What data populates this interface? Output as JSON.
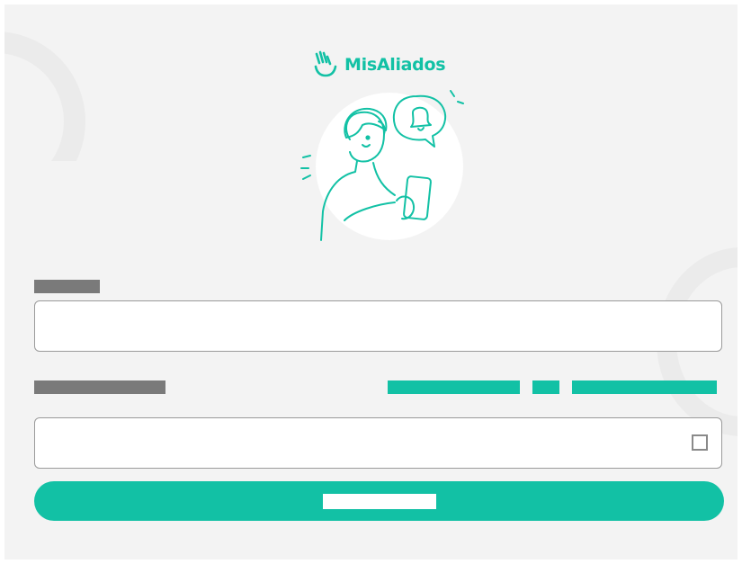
{
  "brand": {
    "name": "MisAliados",
    "accent_color": "#12c1a5",
    "logo_icon": "hand-wave-icon",
    "hero_illustration": "person-with-phone-notification-bell"
  },
  "form": {
    "username_label": "",
    "username_value": "",
    "password_label": "",
    "forgot_links": [
      "",
      "",
      ""
    ],
    "password_value": "",
    "show_password_icon": "checkbox-icon",
    "submit_label": ""
  },
  "colors": {
    "background": "#f3f3f3",
    "placeholder_text_block": "#7a7a7a",
    "input_border": "#9a9a9a"
  }
}
